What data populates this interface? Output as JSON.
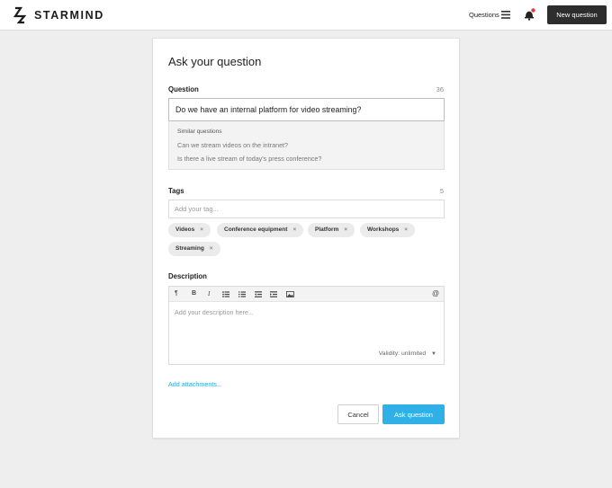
{
  "header": {
    "brand": "STARMIND",
    "questions_label": "Questions",
    "new_question_label": "New question",
    "notification_dot_color": "#e53935"
  },
  "form": {
    "title": "Ask your question",
    "question": {
      "label": "Question",
      "counter": "36",
      "value": "Do we have an internal platform for video streaming?"
    },
    "similar": {
      "title": "Similar questions",
      "items": [
        "Can we stream videos on the intranet?",
        "Is there a live stream of today's press conference?"
      ]
    },
    "tags": {
      "label": "Tags",
      "counter": "5",
      "placeholder": "Add your tag...",
      "items": [
        "Videos",
        "Conference equipment",
        "Platform",
        "Workshops",
        "Streaming"
      ]
    },
    "description": {
      "label": "Description",
      "toolbar": [
        "paragraph-icon",
        "bold-icon",
        "italic-icon",
        "bulleted-list-icon",
        "numbered-list-icon",
        "outdent-icon",
        "indent-icon",
        "image-icon",
        "mention-icon"
      ],
      "placeholder": "Add your description here...",
      "validity": "Validity: unlimited"
    },
    "attachments_label": "Add attachments...",
    "cancel_label": "Cancel",
    "submit_label": "Ask question",
    "accent_color": "#2fb0e6"
  }
}
